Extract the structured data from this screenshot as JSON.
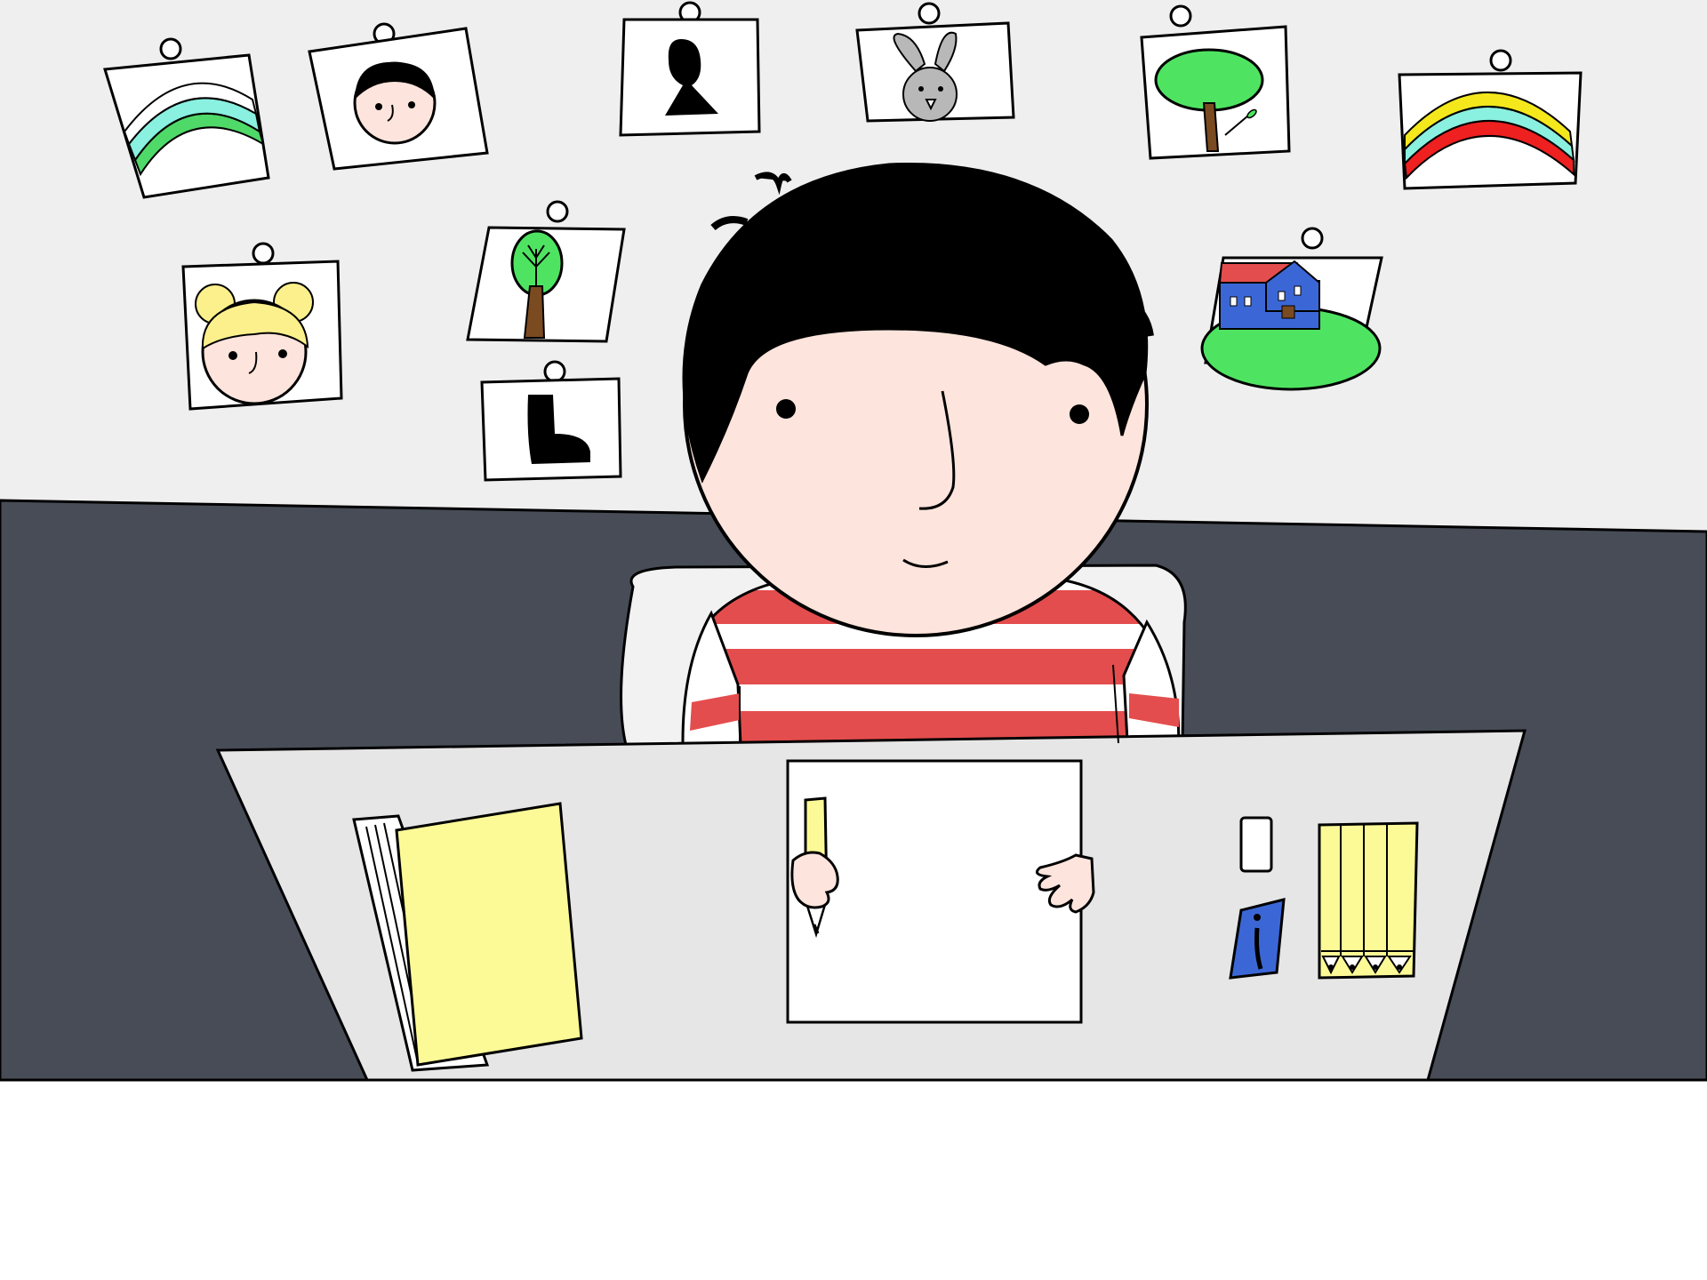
{
  "scene": {
    "description_free": true,
    "colors": {
      "wall": "#efefef",
      "back_wall": "#474c57",
      "desk": "#e6e6e6",
      "floor": "#ffffff",
      "outline": "#000000",
      "skin": "#fde4dc",
      "hair": "#000000",
      "shirt_red": "#e44d4d",
      "shirt_white": "#ffffff",
      "chair": "#f2f2f2",
      "book_yellow": "#fcfa96",
      "pencil_yellow": "#fcfa96",
      "sharpener_blue": "#3b67d6",
      "grass_green": "#4ee462",
      "tree_trunk": "#7a4a20",
      "rainbow_yellow": "#f4e81d",
      "rainbow_cyan": "#8af0e0",
      "rainbow_red": "#ee2020",
      "rainbow_green": "#4fd968",
      "house_blue": "#3b67d6",
      "house_roof": "#e44d4d",
      "bunny_gray": "#b8b8b8",
      "blonde_hair": "#fcf08c"
    },
    "wall_drawings": [
      {
        "name": "rainbow-green-drawing-icon"
      },
      {
        "name": "boy-face-drawing-icon"
      },
      {
        "name": "keyhole-drawing-icon"
      },
      {
        "name": "bunny-drawing-icon"
      },
      {
        "name": "tree-drawing-icon"
      },
      {
        "name": "rainbow-colorful-drawing-icon"
      },
      {
        "name": "girl-face-drawing-icon"
      },
      {
        "name": "small-tree-drawing-icon"
      },
      {
        "name": "house-drawing-icon"
      },
      {
        "name": "boot-drawing-icon"
      }
    ],
    "desk_items": [
      {
        "name": "notebook-icon"
      },
      {
        "name": "paper-sheet-icon"
      },
      {
        "name": "pencil-icon"
      },
      {
        "name": "eraser-icon"
      },
      {
        "name": "sharpener-icon"
      },
      {
        "name": "pencil-set-icon"
      }
    ]
  }
}
